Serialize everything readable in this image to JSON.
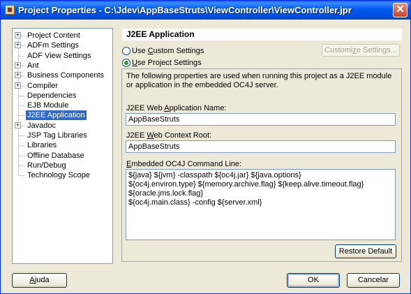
{
  "window": {
    "title": "Project Properties - C:\\Jdev\\AppBaseStruts\\ViewController\\ViewController.jpr",
    "close_glyph": "✕"
  },
  "tree": {
    "items": [
      {
        "label": "Project Content",
        "expander": "+"
      },
      {
        "label": "ADFm Settings",
        "expander": "+"
      },
      {
        "label": "ADF View Settings",
        "expander": ""
      },
      {
        "label": "Ant",
        "expander": "+"
      },
      {
        "label": "Business Components",
        "expander": "+"
      },
      {
        "label": "Compiler",
        "expander": "+"
      },
      {
        "label": "Dependencies",
        "expander": ""
      },
      {
        "label": "EJB Module",
        "expander": ""
      },
      {
        "label": "J2EE Application",
        "expander": "",
        "selected": true
      },
      {
        "label": "Javadoc",
        "expander": "+"
      },
      {
        "label": "JSP Tag Libraries",
        "expander": ""
      },
      {
        "label": "Libraries",
        "expander": ""
      },
      {
        "label": "Offline Database",
        "expander": ""
      },
      {
        "label": "Run/Debug",
        "expander": ""
      },
      {
        "label": "Technology Scope",
        "expander": ""
      }
    ]
  },
  "panel": {
    "header": "J2EE Application",
    "radio_custom": {
      "pre": "Use ",
      "key": "C",
      "post": "ustom Settings"
    },
    "radio_project": {
      "pre": "",
      "key": "U",
      "post": "se Project Settings"
    },
    "customize_button": {
      "pre": "Customi",
      "key": "z",
      "post": "e Settings..."
    },
    "description": "The following properties are used when running this project as a J2EE module or application in the embedded OC4J server.",
    "web_app_name_label": {
      "pre": "J2EE Web ",
      "key": "A",
      "post": "pplication Name:"
    },
    "web_app_name_value": "AppBaseStruts",
    "context_root_label": {
      "pre": "J2EE ",
      "key": "W",
      "post": "eb Context Root:"
    },
    "context_root_value": "AppBaseStruts",
    "command_line_label": {
      "pre": "",
      "key": "E",
      "post": "mbedded OC4J Command Line:"
    },
    "command_lines": [
      "${java} ${jvm} -classpath ${oc4j.jar} ${java.options}",
      "${oc4j.environ.type} ${memory.archive.flag} ${keep.alive.timeout.flag}",
      "${oracle.jms.lock.flag}",
      "${oc4j.main.class} -config ${server.xml}"
    ],
    "restore_button": "Restore Default"
  },
  "footer": {
    "help_button": {
      "key": "A",
      "post": "juda"
    },
    "ok_button": "OK",
    "cancel_button": "Cancelar"
  },
  "colors": {
    "titlebar": "#0058ee",
    "selection": "#316ac5",
    "window_bg": "#ece9d8",
    "radio_dot": "#21a121"
  }
}
